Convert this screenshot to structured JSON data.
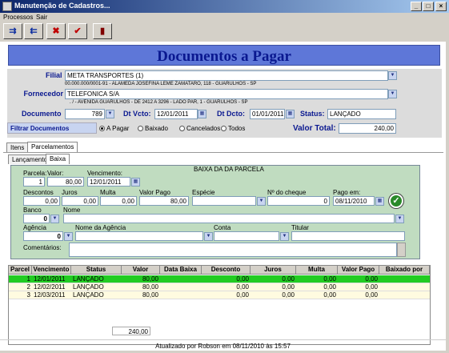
{
  "window": {
    "title": "Manutenção de Cadastros...",
    "btn_min": "_",
    "btn_max": "□",
    "btn_close": "×"
  },
  "menu": {
    "processos": "Processos",
    "sair": "Sair"
  },
  "header": {
    "title": "Documentos a Pagar"
  },
  "filial": {
    "label": "Filial",
    "value": "META TRANSPORTES (1)",
    "sub": "00.000.000/0001-91 - ALAMEDA JOSEFINA LEME ZAMATARO, 118 - GUARULHOS - SP"
  },
  "fornecedor": {
    "label": "Fornecedor",
    "value": "TELEFONICA S/A",
    "sub": ". / - AVENIDA GUARULHOS - DE 2412 A 3296 - LADO PAR, 1 - GUARULHOS - SP"
  },
  "documento": {
    "label": "Documento",
    "value": "789"
  },
  "dt_vcto": {
    "label": "Dt Vcto:",
    "value": "12/01/2011"
  },
  "dt_dcto": {
    "label": "Dt Dcto:",
    "value": "01/01/2011"
  },
  "status": {
    "label": "Status:",
    "value": "LANÇADO"
  },
  "filtro": {
    "label": "Filtrar Documentos",
    "options": [
      "A Pagar",
      "Baixado",
      "Cancelados",
      "Todos"
    ]
  },
  "valor_total": {
    "label": "Valor Total:",
    "value": "240,00"
  },
  "tabs": {
    "itens": "Itens",
    "parcelamentos": "Parcelamentos",
    "lancamento": "Lançamento",
    "baixa": "Baixa"
  },
  "baixa": {
    "group_title": "BAIXA DA DA PARCELA",
    "parcela_label": "Parcela:",
    "parcela": "1",
    "valor_label": "Valor:",
    "valor": "80,00",
    "vencimento_label": "Vencimento:",
    "vencimento": "12/01/2011",
    "descontos_label": "Descontos",
    "descontos": "0,00",
    "juros_label": "Juros",
    "juros": "0,00",
    "multa_label": "Multa",
    "multa": "0,00",
    "valor_pago_label": "Valor Pago",
    "valor_pago": "80,00",
    "especie_label": "Espécie",
    "especie": "",
    "cheque_label": "Nº do cheque",
    "cheque": "0",
    "pago_em_label": "Pago em:",
    "pago_em": "08/11/2010",
    "banco_label": "Banco",
    "banco": "0",
    "nome_label": "Nome",
    "nome": "",
    "agencia_label": "Agência",
    "agencia": "0",
    "nome_agencia_label": "Nome da Agência",
    "nome_agencia": "",
    "conta_label": "Conta",
    "conta": "",
    "titular_label": "Titular",
    "titular": "",
    "comentarios_label": "Comentários:",
    "comentarios": ""
  },
  "table": {
    "columns": [
      "Parcel",
      "Vencimento",
      "Status",
      "Valor",
      "Data Baixa",
      "Desconto",
      "Juros",
      "Multa",
      "Valor Pago",
      "Baixado por"
    ],
    "rows": [
      [
        "1",
        "12/01/2011",
        "LANÇADO",
        "80,00",
        "",
        "0,00",
        "0,00",
        "0,00",
        "0,00",
        ""
      ],
      [
        "2",
        "12/02/2011",
        "LANÇADO",
        "80,00",
        "",
        "0,00",
        "0,00",
        "0,00",
        "0,00",
        ""
      ],
      [
        "3",
        "12/03/2011",
        "LANÇADO",
        "80,00",
        "",
        "0,00",
        "0,00",
        "0,00",
        "0,00",
        ""
      ]
    ],
    "total": "240,00"
  },
  "footer": {
    "text": "Atualizado por Robson em 08/11/2010 às 15:57"
  }
}
